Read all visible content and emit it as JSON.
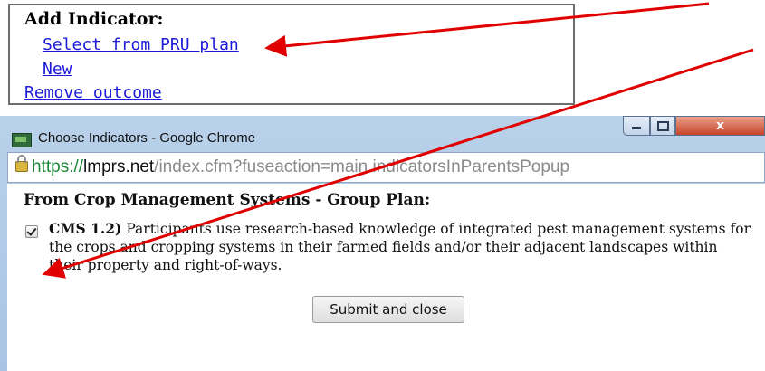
{
  "indicator_box": {
    "title": "Add Indicator:",
    "select_link": "Select from PRU plan",
    "new_link": "New",
    "remove_link": "Remove outcome"
  },
  "window": {
    "title": "Choose Indicators - Google Chrome",
    "controls": {
      "minimize": "–",
      "maximize": "□",
      "close": "x"
    },
    "url": {
      "scheme": "https://",
      "host": "lmprs.net",
      "path": "/index.cfm?fuseaction=main.indicatorsInParentsPopup"
    }
  },
  "popup": {
    "heading": "From Crop Management Systems - Group Plan:",
    "item": {
      "code": "CMS 1.2)",
      "text": " Participants use research-based knowledge of integrated pest management systems for the crops and cropping systems in their farmed fields and/or their adjacent landscapes within their property and right-of-ways.",
      "checked": true
    },
    "submit_label": "Submit and close"
  },
  "colors": {
    "link": "#1a1ad8",
    "annotation_arrow": "#e00000",
    "url_scheme": "#1c8a3a"
  },
  "icons": [
    "app-icon",
    "lock-icon",
    "checkbox-icon"
  ]
}
